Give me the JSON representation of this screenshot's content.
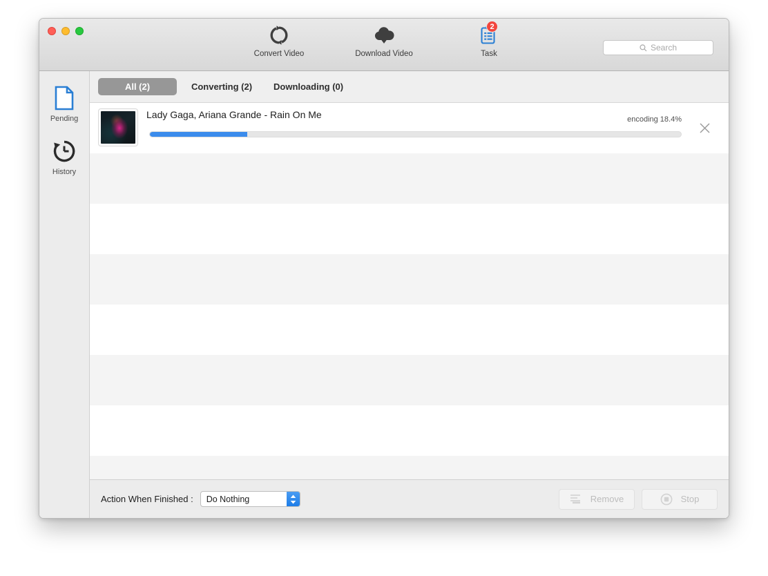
{
  "window": {
    "traffic_lights": [
      "close",
      "minimize",
      "zoom"
    ]
  },
  "toolbar": {
    "items": [
      {
        "label": "Convert Video",
        "icon": "convert-refresh-icon",
        "badge": null
      },
      {
        "label": "Download Video",
        "icon": "download-cloud-icon",
        "badge": null
      },
      {
        "label": "Task",
        "icon": "task-clipboard-icon",
        "badge": "2"
      }
    ],
    "search": {
      "placeholder": "Search",
      "value": "",
      "icon": "search-icon"
    }
  },
  "sidebar": {
    "items": [
      {
        "label": "Pending",
        "icon": "document-icon",
        "active": true
      },
      {
        "label": "History",
        "icon": "clock-history-icon",
        "active": false
      }
    ]
  },
  "tabs": [
    {
      "label": "All (2)",
      "active": true
    },
    {
      "label": "Converting (2)",
      "active": false
    },
    {
      "label": "Downloading (0)",
      "active": false
    }
  ],
  "tasks": [
    {
      "title": "Lady Gaga, Ariana Grande - Rain On Me",
      "status": "encoding 18.4%",
      "progress_percent": 18.4,
      "close_icon": "close-x-icon"
    }
  ],
  "empty_rows": 8,
  "footer": {
    "action_label": "Action When Finished :",
    "action_value": "Do Nothing",
    "action_options": [
      "Do Nothing"
    ],
    "buttons": [
      {
        "label": "Remove",
        "icon": "remove-list-icon",
        "disabled": true
      },
      {
        "label": "Stop",
        "icon": "stop-circle-icon",
        "disabled": true
      }
    ]
  },
  "colors": {
    "accent_blue": "#3b8cec",
    "badge_red": "#f2453d",
    "tab_active_bg": "#979797",
    "stripe": "#f4f4f4"
  }
}
